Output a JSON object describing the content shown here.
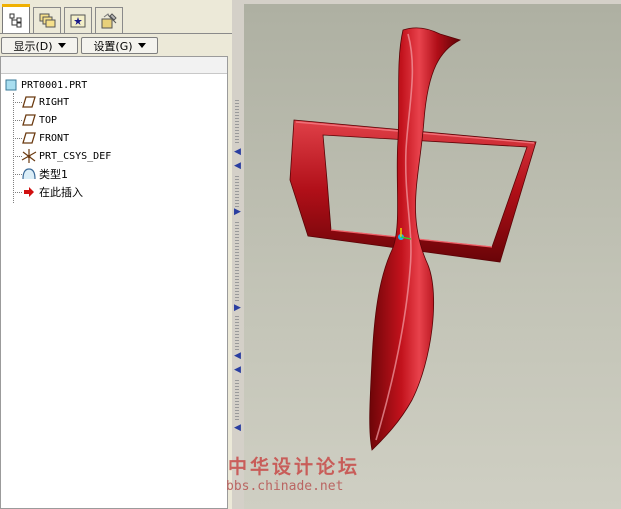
{
  "toolbar": {
    "tabs": [
      "model-tree-icon",
      "layers-icon",
      "favorites-icon",
      "tools-icon"
    ],
    "show_label": "显示(D)",
    "settings_label": "设置(G)"
  },
  "tree": {
    "root": "PRT0001.PRT",
    "items": [
      {
        "label": "RIGHT",
        "icon": "datum-plane-icon"
      },
      {
        "label": "TOP",
        "icon": "datum-plane-icon"
      },
      {
        "label": "FRONT",
        "icon": "datum-plane-icon"
      },
      {
        "label": "PRT_CSYS_DEF",
        "icon": "coordinate-system-icon"
      },
      {
        "label": "类型1",
        "icon": "feature-icon"
      },
      {
        "label": "在此插入",
        "icon": "insert-here-arrow-icon"
      }
    ]
  },
  "watermark": {
    "chinese": "中华设计论坛",
    "url": "bbs.chinade.net"
  },
  "colors": {
    "model_red": "#b0101a",
    "tab_highlight": "#f0b000",
    "watermark": "#c84a48"
  }
}
